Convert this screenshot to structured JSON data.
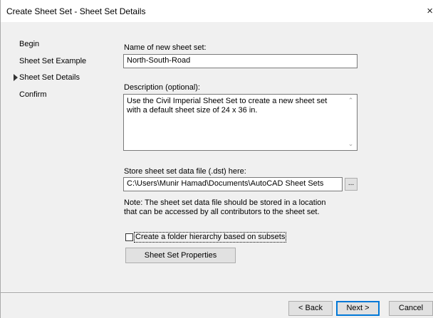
{
  "window": {
    "title": "Create Sheet Set - Sheet Set Details",
    "close_glyph": "×"
  },
  "nav": {
    "items": [
      {
        "label": "Begin"
      },
      {
        "label": "Sheet Set Example"
      },
      {
        "label": "Sheet Set Details",
        "current": true
      },
      {
        "label": "Confirm"
      }
    ]
  },
  "form": {
    "name_label": "Name of new sheet set:",
    "name_value": "North-South-Road",
    "description_label": "Description (optional):",
    "description_value": "Use the Civil Imperial Sheet Set to create a new sheet set with a default sheet size of 24 x 36 in.",
    "store_label": "Store sheet set data file (.dst) here:",
    "store_path": "C:\\Users\\Munir Hamad\\Documents\\AutoCAD Sheet Sets",
    "browse_label": "...",
    "note": "Note: The sheet set data file should be stored in a location that can be accessed by all contributors to the sheet set.",
    "folder_hierarchy_label": "Create a folder hierarchy based on subsets",
    "folder_hierarchy_checked": false,
    "properties_button": "Sheet Set Properties"
  },
  "footer": {
    "back_label": "< Back",
    "next_label": "Next >",
    "cancel_label": "Cancel"
  },
  "icons": {
    "close": "close-icon",
    "current_step": "triangle-right-icon",
    "scroll_up": "chevron-up-icon",
    "scroll_down": "chevron-down-icon"
  },
  "colors": {
    "dialog_bg": "#f0f0f0",
    "focus_border": "#0078d7"
  }
}
